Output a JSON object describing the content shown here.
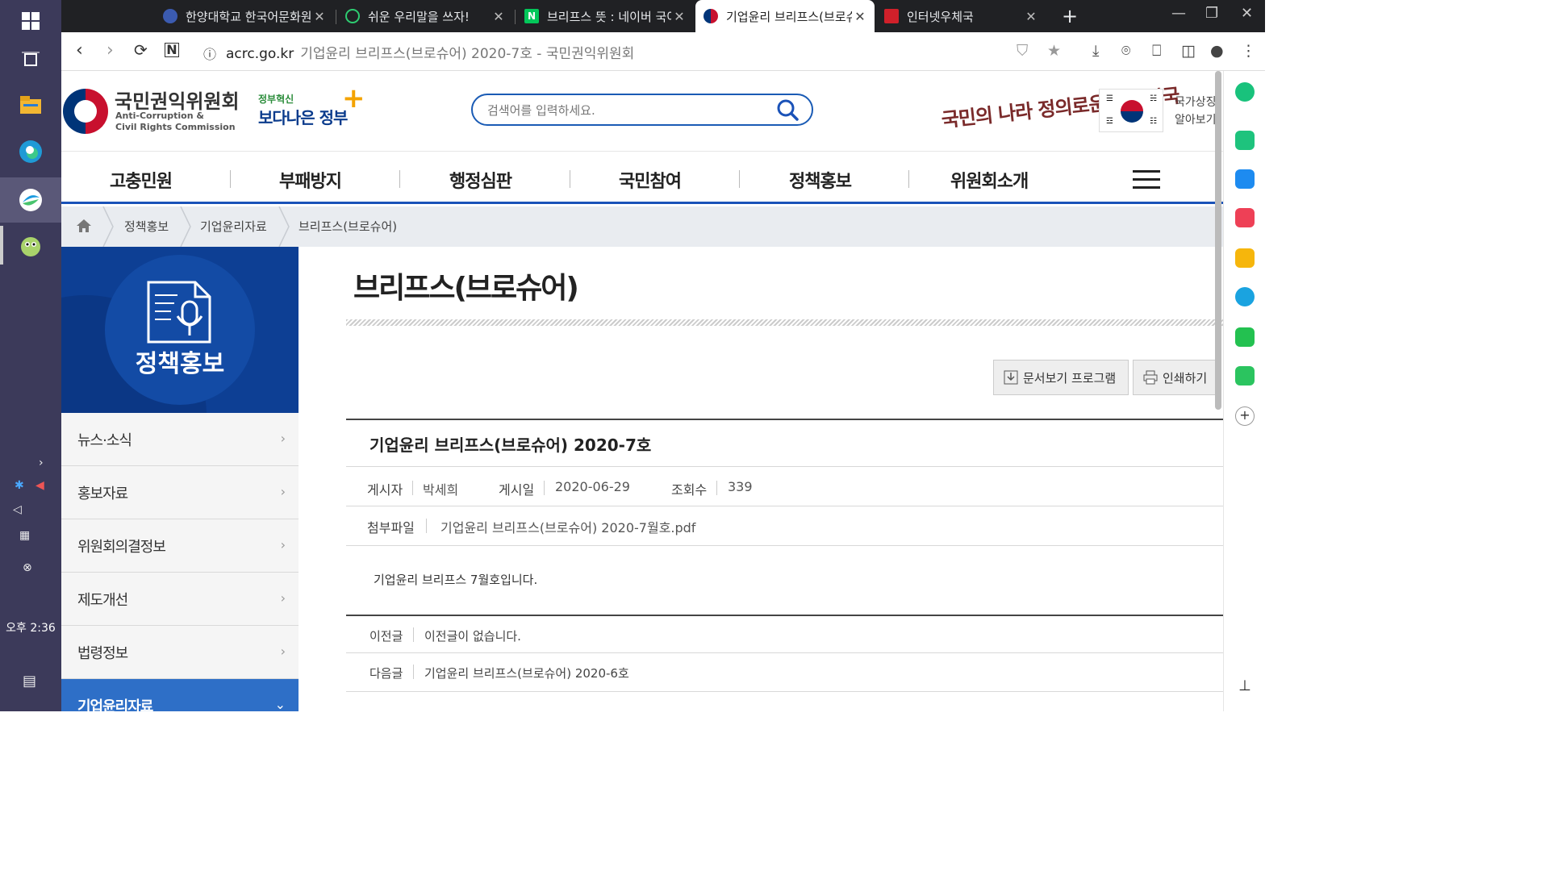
{
  "taskbar": {
    "clock": "오후 2:36",
    "items": [
      "windows-start",
      "task-view",
      "file-explorer",
      "edge",
      "browser-active",
      "game-app"
    ]
  },
  "tabs": [
    {
      "title": "한양대학교 한국어문화원",
      "icon": "hanyang-favicon"
    },
    {
      "title": "쉬운 우리말을 쓰자!",
      "icon": "circle-favicon"
    },
    {
      "title": "브리프스 뜻 : 네이버 국어사전",
      "icon": "naver-favicon"
    },
    {
      "title": "기업윤리 브리프스(브로슈어)",
      "icon": "acrc-favicon",
      "active": true
    },
    {
      "title": "인터넷우체국",
      "icon": "post-favicon"
    }
  ],
  "address": {
    "domain": "acrc.go.kr",
    "page_title": "기업윤리 브리프스(브로슈어) 2020-7호 - 국민권익위원회"
  },
  "header": {
    "org_name_ko": "국민권익위원회",
    "org_name_en_1": "Anti-Corruption &",
    "org_name_en_2": "Civil Rights Commission",
    "gov_small": "정부혁신",
    "gov_big": "보다나은 정부",
    "search_placeholder": "검색어를 입력하세요.",
    "slogan": "국민의 나라 정의로운 대한민국",
    "national_symbol_1": "국가상징",
    "national_symbol_2": "알아보기"
  },
  "gnb": [
    "고충민원",
    "부패방지",
    "행정심판",
    "국민참여",
    "정책홍보",
    "위원회소개"
  ],
  "breadcrumb": [
    "정책홍보",
    "기업윤리자료",
    "브리프스(브로슈어)"
  ],
  "lnb": {
    "title": "정책홍보",
    "items": [
      {
        "label": "뉴스·소식",
        "active": false
      },
      {
        "label": "홍보자료",
        "active": false
      },
      {
        "label": "위원회의결정보",
        "active": false
      },
      {
        "label": "제도개선",
        "active": false
      },
      {
        "label": "법령정보",
        "active": false
      },
      {
        "label": "기업윤리자료",
        "active": true
      }
    ]
  },
  "content": {
    "page_title": "브리프스(브로슈어)",
    "buttons": {
      "viewer": "문서보기 프로그램",
      "print": "인쇄하기"
    },
    "post": {
      "title": "기업윤리 브리프스(브로슈어) 2020-7호",
      "author_label": "게시자",
      "author": "박세희",
      "date_label": "게시일",
      "date": "2020-06-29",
      "views_label": "조회수",
      "views": "339",
      "attach_label": "첨부파일",
      "attachment": "기업윤리 브리프스(브로슈어) 2020-7월호.pdf",
      "body": "기업윤리 브리프스 7월호입니다."
    },
    "prev_label": "이전글",
    "prev": "이전글이 없습니다.",
    "next_label": "다음글",
    "next": "기업윤리 브리프스(브로슈어) 2020-6호"
  },
  "colors": {
    "primary": "#1a52b8",
    "lnb_dark": "#0d3f94",
    "lnb_active": "#2e6fc7"
  }
}
